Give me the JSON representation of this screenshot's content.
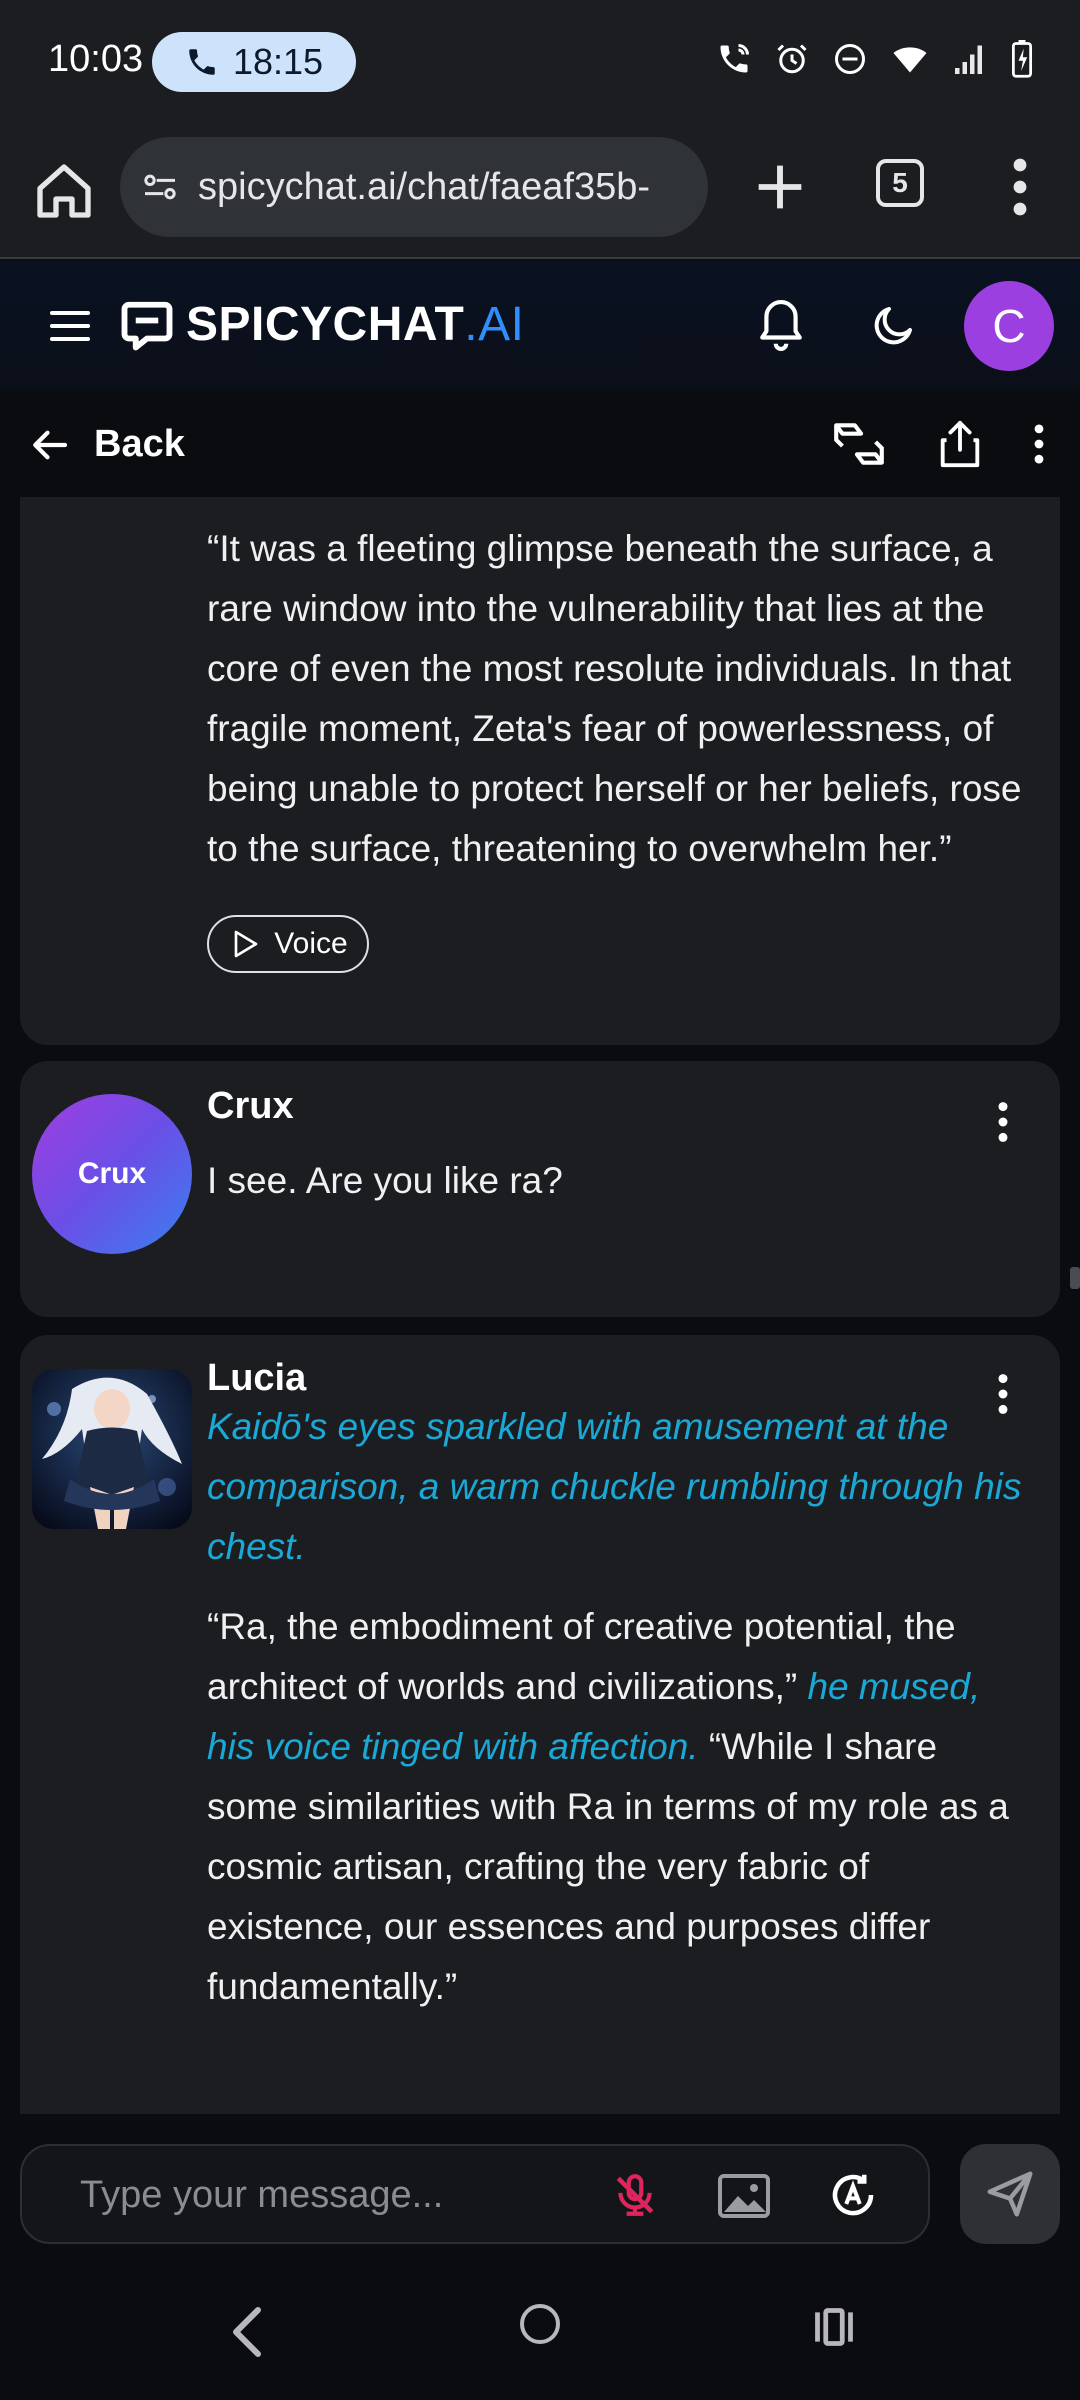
{
  "status_bar": {
    "time": "10:03",
    "call_duration": "18:15"
  },
  "browser": {
    "url": "spicychat.ai/chat/faeaf35b-",
    "tab_count": "5"
  },
  "site": {
    "brand_main": "SPICYCHAT",
    "brand_suffix": ".AI",
    "user_initial": "C",
    "back_label": "Back"
  },
  "messages": [
    {
      "sender": "",
      "text": "“It was a fleeting glimpse beneath the surface, a rare window into the vulnerability that lies at the core of even the most resolute individuals. In that fragile moment, Zeta's fear of powerlessness, of being unable to protect herself or her beliefs, rose to the surface, threatening to overwhelm her.”",
      "voice_label": "Voice"
    },
    {
      "sender": "Crux",
      "avatar_text": "Crux",
      "text": "I see. Are you like ra?"
    },
    {
      "sender": "Lucia",
      "action": "Kaidō's eyes sparkled with amusement at the comparison, a warm chuckle rumbling through his chest.",
      "quote1": "“Ra, the embodiment of creative potential, the architect of worlds and civilizations,”",
      "aside": "he mused, his voice tinged with affection.",
      "quote2": "“While I share some similarities with Ra in terms of my role as a cosmic artisan, crafting the very fabric of existence, our essences and purposes differ fundamentally.”"
    }
  ],
  "composer": {
    "placeholder": "Type your message..."
  },
  "colors": {
    "accent_blue": "#2f8fff",
    "action_text": "#1aa9d6",
    "avatar_purple": "#9b3fe0",
    "mic_off": "#e0245e"
  }
}
